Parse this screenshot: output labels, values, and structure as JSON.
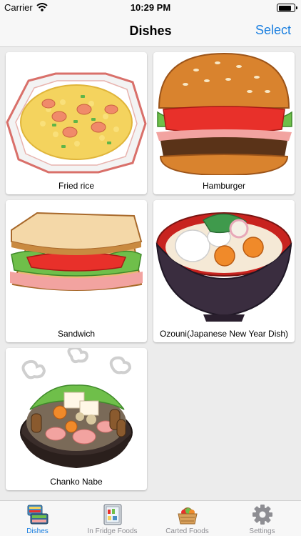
{
  "status_bar": {
    "carrier": "Carrier",
    "time": "10:29 PM"
  },
  "nav": {
    "title": "Dishes",
    "select_label": "Select"
  },
  "dishes": [
    {
      "name": "Fried rice",
      "icon": "fried-rice-illustration"
    },
    {
      "name": "Hamburger",
      "icon": "hamburger-illustration"
    },
    {
      "name": "Sandwich",
      "icon": "sandwich-illustration"
    },
    {
      "name": "Ozouni(Japanese New Year Dish)",
      "icon": "ozouni-soup-illustration"
    },
    {
      "name": "Chanko Nabe",
      "icon": "hot-pot-illustration"
    }
  ],
  "tabs": [
    {
      "label": "Dishes",
      "icon": "dishes-icon",
      "active": true
    },
    {
      "label": "In Fridge Foods",
      "icon": "fridge-icon",
      "active": false
    },
    {
      "label": "Carted Foods",
      "icon": "basket-icon",
      "active": false
    },
    {
      "label": "Settings",
      "icon": "gear-icon",
      "active": false
    }
  ],
  "colors": {
    "accent": "#1a7fe0",
    "inactive_tab": "#8e8e93",
    "grid_background": "#ececec"
  }
}
